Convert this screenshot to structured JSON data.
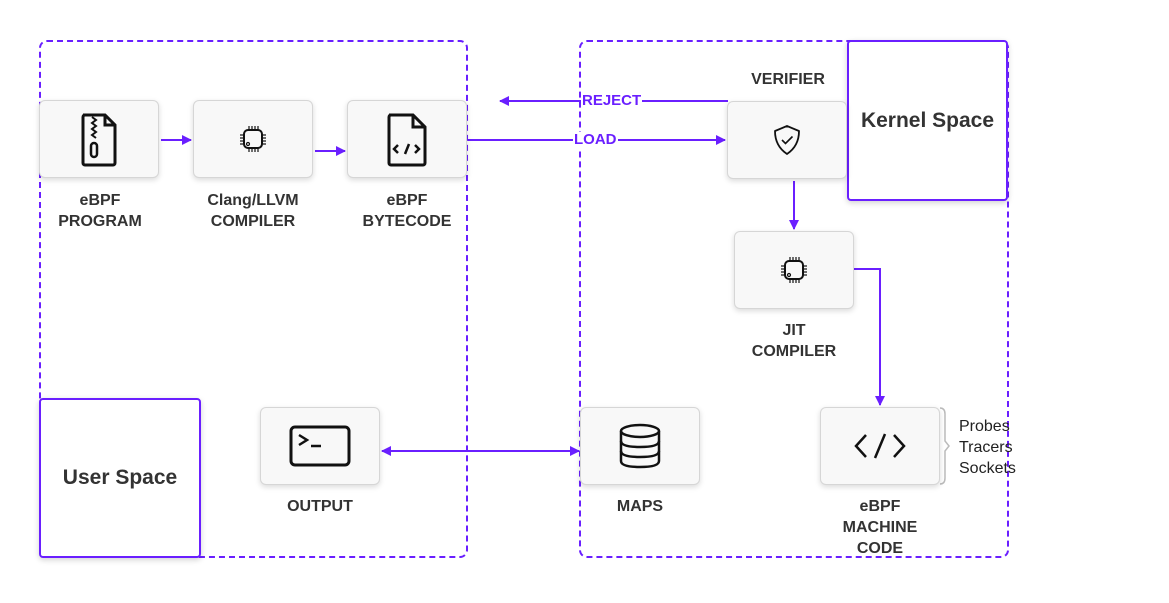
{
  "regions": {
    "user_space": "User Space",
    "kernel_space": "Kernel Space"
  },
  "nodes": {
    "ebpf_program": {
      "line1": "eBPF",
      "line2": "PROGRAM",
      "icon": "zip-file-icon"
    },
    "compiler": {
      "line1": "Clang/LLVM",
      "line2": "COMPILER",
      "icon": "chip-icon"
    },
    "bytecode": {
      "line1": "eBPF",
      "line2": "BYTECODE",
      "icon": "code-file-icon"
    },
    "verifier": {
      "title": "VERIFIER",
      "icon": "shield-check-icon"
    },
    "jit": {
      "line1": "JIT",
      "line2": "COMPILER",
      "icon": "chip-icon"
    },
    "machine_code": {
      "line1": "eBPF",
      "line2": "MACHINE",
      "line3": "CODE",
      "icon": "code-brackets-icon"
    },
    "maps": {
      "line1": "MAPS",
      "icon": "database-icon"
    },
    "output": {
      "line1": "OUTPUT",
      "icon": "terminal-icon"
    }
  },
  "edges": {
    "reject": "REJECT",
    "load": "LOAD"
  },
  "attach_points": [
    "Probes",
    "Tracers",
    "Sockets"
  ],
  "colors": {
    "accent": "#6a1fff",
    "text": "#333333",
    "node_bg": "#f8f8f8"
  }
}
